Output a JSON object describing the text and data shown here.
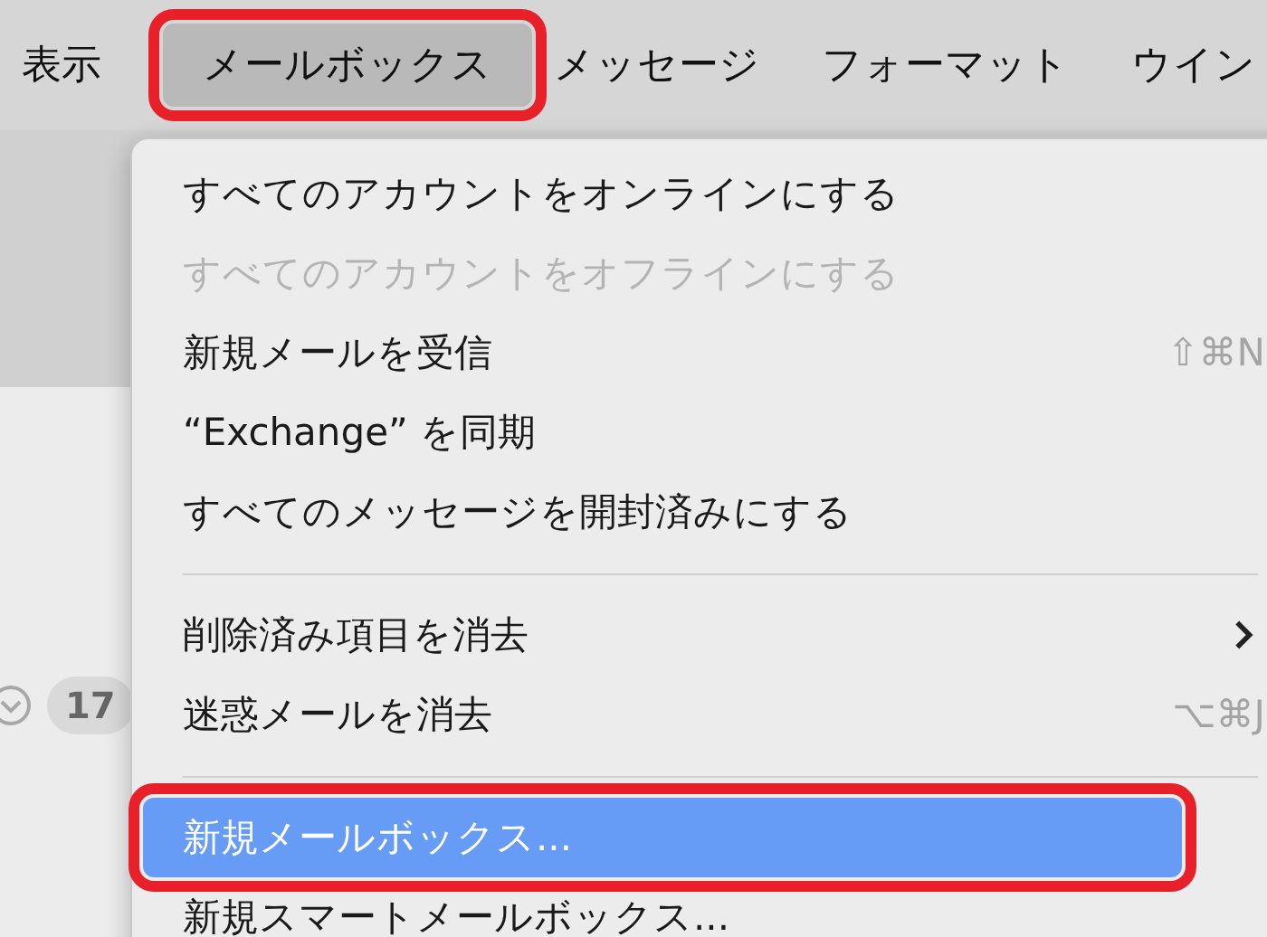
{
  "menu_bar": [
    {
      "label": "表示",
      "selected": false,
      "highlighted": false
    },
    {
      "label": "メールボックス",
      "selected": true,
      "highlighted": true
    },
    {
      "label": "メッセージ",
      "selected": false,
      "highlighted": false
    },
    {
      "label": "フォーマット",
      "selected": false,
      "highlighted": false
    },
    {
      "label": "ウイン",
      "selected": false,
      "highlighted": false
    }
  ],
  "background": {
    "badge": "17"
  },
  "menu": [
    {
      "kind": "item",
      "label": "すべてのアカウントをオンラインにする",
      "disabled": false,
      "selected": false,
      "highlighted": false
    },
    {
      "kind": "item",
      "label": "すべてのアカウントをオフラインにする",
      "disabled": true,
      "selected": false,
      "highlighted": false
    },
    {
      "kind": "item",
      "label": "新規メールを受信",
      "shortcut": "⇧⌘N",
      "disabled": false,
      "selected": false,
      "highlighted": false
    },
    {
      "kind": "item",
      "label": "“Exchange” を同期",
      "disabled": false,
      "selected": false,
      "highlighted": false
    },
    {
      "kind": "item",
      "label": "すべてのメッセージを開封済みにする",
      "disabled": false,
      "selected": false,
      "highlighted": false
    },
    {
      "kind": "separator"
    },
    {
      "kind": "submenu",
      "label": "削除済み項目を消去",
      "disabled": false,
      "selected": false,
      "highlighted": false
    },
    {
      "kind": "item",
      "label": "迷惑メールを消去",
      "shortcut": "⌥⌘J",
      "disabled": false,
      "selected": false,
      "highlighted": false
    },
    {
      "kind": "separator"
    },
    {
      "kind": "item",
      "label": "新規メールボックス...",
      "disabled": false,
      "selected": true,
      "highlighted": true
    },
    {
      "kind": "item",
      "label": "新規スマートメールボックス...",
      "disabled": false,
      "selected": false,
      "highlighted": false
    }
  ]
}
